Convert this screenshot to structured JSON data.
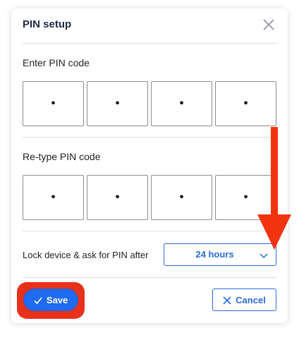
{
  "dialog": {
    "title": "PIN setup",
    "close_icon": "close-icon"
  },
  "pin_entry": {
    "label": "Enter PIN code",
    "digits": [
      "•",
      "•",
      "•",
      "•"
    ]
  },
  "pin_retype": {
    "label": "Re-type PIN code",
    "digits": [
      "•",
      "•",
      "•",
      "•"
    ]
  },
  "lock": {
    "label": "Lock device & ask for PIN after",
    "selected": "24 hours",
    "chevron_icon": "chevron-down-icon"
  },
  "actions": {
    "save_label": "Save",
    "save_icon": "check-icon",
    "cancel_label": "Cancel",
    "cancel_icon": "close-icon"
  },
  "colors": {
    "accent": "#1f6bf2",
    "outline": "#2a6bd6",
    "annotation": "#e8311a"
  }
}
